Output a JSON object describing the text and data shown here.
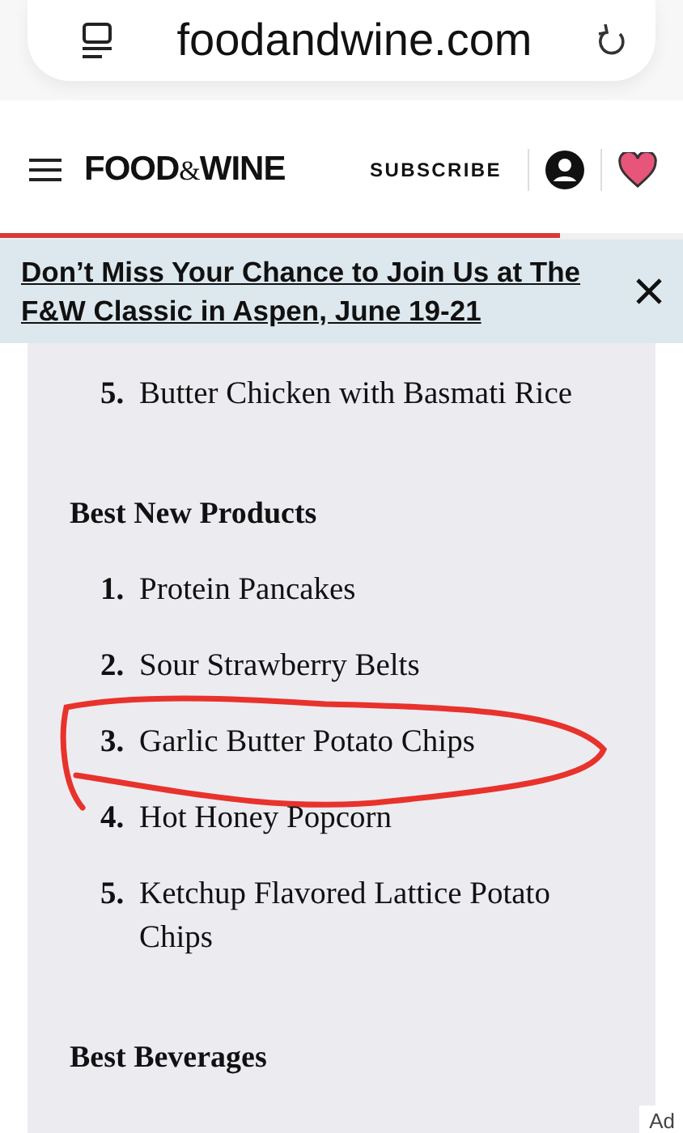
{
  "browser": {
    "address": "foodandwine.com"
  },
  "header": {
    "logo_left": "FOOD",
    "logo_amp": "&",
    "logo_right": "WINE",
    "subscribe": "SUBSCRIBE"
  },
  "reading_progress": {
    "level": 0.82
  },
  "banner": {
    "text": "Don’t Miss Your Chance to Join Us at The F&W Classic in Aspen, June 19-21"
  },
  "sections": [
    {
      "items": [
        {
          "number": "5.",
          "text": "Butter Chicken with Basmati Rice",
          "circled": false
        }
      ]
    },
    {
      "heading": "Best New Products",
      "items": [
        {
          "number": "1.",
          "text": "Protein Pancakes",
          "circled": false
        },
        {
          "number": "2.",
          "text": "Sour Strawberry Belts",
          "circled": false
        },
        {
          "number": "3.",
          "text": "Garlic Butter Potato Chips",
          "circled": true
        },
        {
          "number": "4.",
          "text": "Hot Honey Popcorn",
          "circled": false
        },
        {
          "number": "5.",
          "text": "Ketchup Flavored Lattice Potato Chips",
          "circled": false
        }
      ]
    },
    {
      "heading": "Best Beverages"
    }
  ],
  "ad_label": "Ad"
}
